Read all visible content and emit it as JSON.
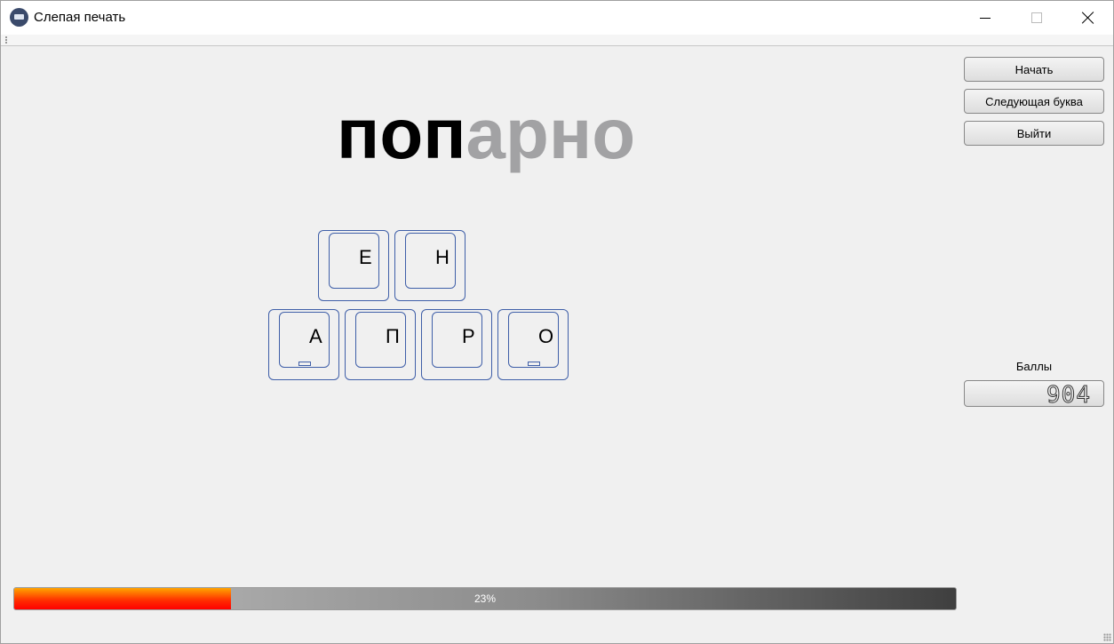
{
  "window": {
    "title": "Слепая печать",
    "icon": "keyboard-icon"
  },
  "word": {
    "typed": "поп",
    "remaining": "арно"
  },
  "keys": [
    {
      "label": "Е",
      "bump": false
    },
    {
      "label": "Н",
      "bump": false
    },
    {
      "label": "А",
      "bump": true
    },
    {
      "label": "П",
      "bump": false
    },
    {
      "label": "Р",
      "bump": false
    },
    {
      "label": "О",
      "bump": true
    }
  ],
  "buttons": {
    "start": "Начать",
    "next_letter": "Следующая буква",
    "exit": "Выйти"
  },
  "score": {
    "label": "Баллы",
    "value": "904"
  },
  "progress": {
    "percent": 23,
    "text": "23%"
  },
  "colors": {
    "key_border": "#3f5fa8",
    "remaining_text": "#a2a2a4",
    "progress_fill_start": "#ffa500",
    "progress_fill_end": "#ff0000"
  }
}
